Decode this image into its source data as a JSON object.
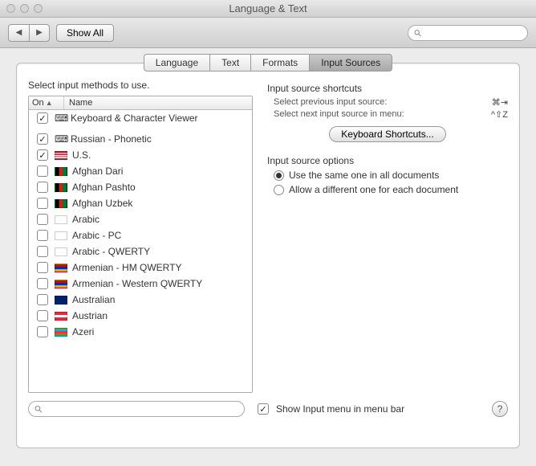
{
  "window": {
    "title": "Language & Text"
  },
  "toolbar": {
    "show_all": "Show All",
    "search_placeholder": ""
  },
  "tabs": {
    "language": "Language",
    "text": "Text",
    "formats": "Formats",
    "input_sources": "Input Sources"
  },
  "instruct": "Select input methods to use.",
  "list": {
    "col_on": "On",
    "col_name": "Name",
    "items": [
      {
        "checked": true,
        "name": "Keyboard & Character Viewer",
        "flag": null,
        "icon": "viewer"
      },
      {
        "gap": true
      },
      {
        "checked": true,
        "name": "Russian - Phonetic",
        "flag": null,
        "icon": "keyboard"
      },
      {
        "checked": true,
        "name": "U.S.",
        "flag": "us"
      },
      {
        "checked": false,
        "name": "Afghan Dari",
        "flag": "af"
      },
      {
        "checked": false,
        "name": "Afghan Pashto",
        "flag": "af"
      },
      {
        "checked": false,
        "name": "Afghan Uzbek",
        "flag": "af"
      },
      {
        "checked": false,
        "name": "Arabic",
        "flag": "arabic"
      },
      {
        "checked": false,
        "name": "Arabic - PC",
        "flag": "arabic-pc"
      },
      {
        "checked": false,
        "name": "Arabic - QWERTY",
        "flag": "arabic"
      },
      {
        "checked": false,
        "name": "Armenian - HM QWERTY",
        "flag": "am"
      },
      {
        "checked": false,
        "name": "Armenian - Western QWERTY",
        "flag": "am"
      },
      {
        "checked": false,
        "name": "Australian",
        "flag": "au"
      },
      {
        "checked": false,
        "name": "Austrian",
        "flag": "at"
      },
      {
        "checked": false,
        "name": "Azeri",
        "flag": "az"
      }
    ]
  },
  "right": {
    "shortcuts_title": "Input source shortcuts",
    "prev_label": "Select previous input source:",
    "prev_key": "⌘⇥",
    "next_label": "Select next input source in menu:",
    "next_key": "^⇧Z",
    "shortcut_btn": "Keyboard Shortcuts...",
    "options_title": "Input source options",
    "opt_same": "Use the same one in all documents",
    "opt_diff": "Allow a different one for each document"
  },
  "footer": {
    "show_menu": "Show Input menu in menu bar",
    "show_menu_checked": true
  },
  "flags": {
    "us": "linear-gradient(#b22234 0 15%,#fff 15% 30%,#b22234 30% 45%,#fff 45% 60%,#b22234 60% 75%,#fff 75% 90%,#b22234 90%)",
    "af": "linear-gradient(90deg,#000 0 33%,#d32011 33% 66%,#007a36 66%)",
    "am": "linear-gradient(#d90012 0 33%,#0033a0 33% 66%,#f2a800 66%)",
    "au": "linear-gradient(#012169,#012169)",
    "at": "linear-gradient(#ed2939 0 33%,#fff 33% 66%,#ed2939 66%)",
    "az": "linear-gradient(#00b5e2 0 33%,#ef3340 33% 66%,#509e2f 66%)",
    "arabic": "#fff",
    "arabic-pc": "#fff"
  }
}
